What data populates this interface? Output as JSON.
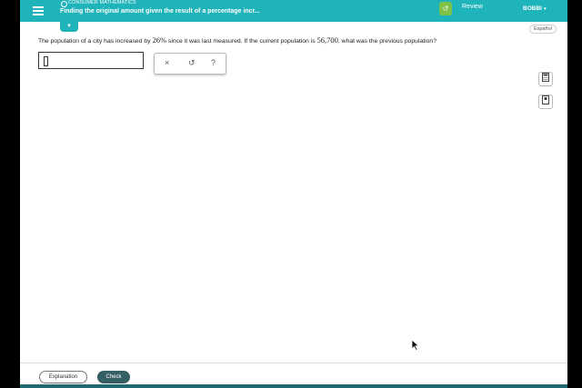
{
  "header": {
    "topic": "CONSUMER MATHEMATICS",
    "title": "Finding the original amount given the result of a percentage incr...",
    "review_label": "Review",
    "user_name": "BOBBI",
    "user_caret": "▾",
    "badge_icon": "↺"
  },
  "language_toggle": "Español",
  "question": {
    "prefix": "The population of a city has increased by ",
    "percent": "26%",
    "middle": " since it was last measured. If the current population is ",
    "population": "56,700",
    "suffix": ", what was the previous population?"
  },
  "answer_input": {
    "value": ""
  },
  "tool_panel": {
    "clear": "×",
    "undo": "↺",
    "help": "?"
  },
  "footer": {
    "explanation_label": "Explanation",
    "check_label": "Check"
  },
  "colors": {
    "header": "#1fb3ba",
    "check_button": "#365f63",
    "badge": "#7ec24a"
  }
}
